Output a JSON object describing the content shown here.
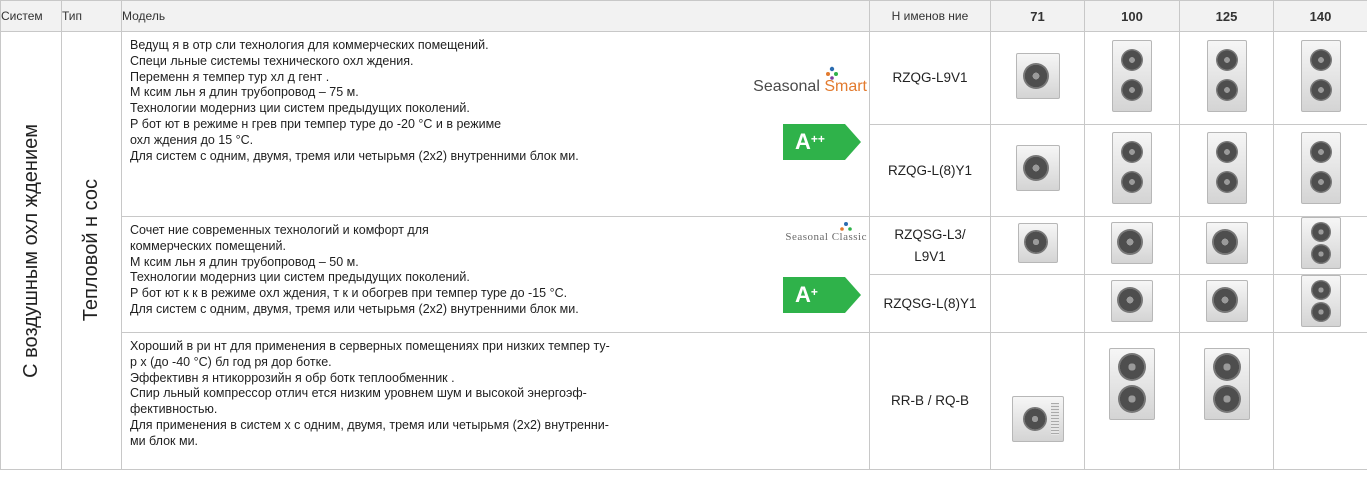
{
  "header": {
    "system": "Систем",
    "type": "Тип",
    "model": "Модель",
    "name": "Н именов ние",
    "capacities": [
      "71",
      "100",
      "125",
      "140"
    ]
  },
  "left": {
    "system_label": "С воздушным охл ждением",
    "type_label": "Тепловой н сос"
  },
  "rows": [
    {
      "desc": [
        "Ведущ я в отр сли технология для коммерческих помещений.",
        "Специ льные системы технического охл ждения.",
        "Переменн я темпер тур хл д гент .",
        "М ксим льн я длин трубопровод – 75 м.",
        "Технологии модерниз ции систем предыдущих поколений.",
        "Р бот ют в режиме н грев при темпер туре до -20 °С и в режиме",
        "охл ждения до 15 °С.",
        "Для систем с одним, двумя, тремя или четырьмя (2x2) внутренними блок ми."
      ],
      "seasonal_a": "Seasonal ",
      "seasonal_b": "Smart",
      "energy_class": "A",
      "energy_sup": "++",
      "models": [
        "RZQG-L9V1",
        "RZQG-L(8)Y1"
      ]
    },
    {
      "desc": [
        "Сочет ние современных технологий и комфорт для",
        "коммерческих помещений.",
        "М ксим льн я длин трубопровод – 50 м.",
        "Технологии модерниз ции систем предыдущих поколений.",
        "Р бот ют к к в режиме охл ждения, т к и обогрев при темпер туре до -15 °С.",
        "Для систем с одним, двумя, тремя или четырьмя (2x2) внутренними блок ми."
      ],
      "seasonal_classic": "Seasonal Classic",
      "energy_class": "A",
      "energy_sup": "+",
      "models": [
        "RZQSG-L3/ L9V1",
        "RZQSG-L(8)Y1"
      ]
    },
    {
      "desc": [
        "Хороший в ри нт для применения в серверных помещениях при низких темпер ту-",
        "р х (до -40 °С) бл год ря дор ботке.",
        "Эффективн я нтикоррозийн я обр ботк теплообменник .",
        "Спир льный компрессор отлич ется низким уровнем шум и высокой энергоэф-",
        "фективностью.",
        "Для применения в систем х с одним, двумя, тремя или четырьмя (2x2) внутренни-",
        "ми блок ми."
      ],
      "models": [
        "RR-B / RQ-B"
      ]
    }
  ],
  "colors": {
    "energy_green": "#2fb24a",
    "border": "#c8c8c8",
    "header_bg": "#f2f2f2"
  }
}
